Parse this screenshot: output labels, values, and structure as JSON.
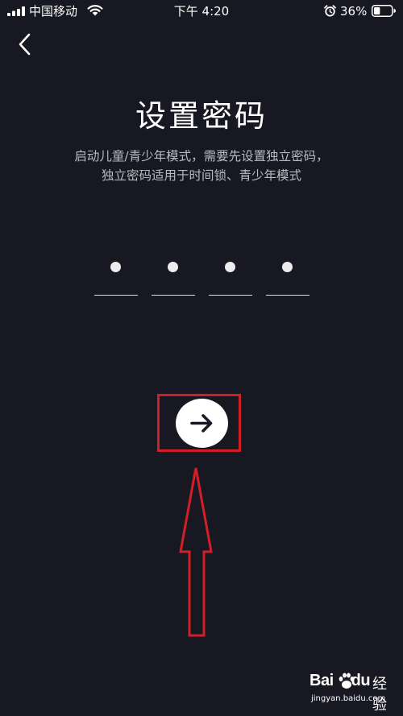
{
  "status_bar": {
    "carrier": "中国移动",
    "time": "下午 4:20",
    "battery_percent": "36%",
    "icons": [
      "signal-icon",
      "wifi-icon",
      "alarm-icon",
      "battery-icon"
    ],
    "battery_level": 0.36
  },
  "nav": {
    "back_icon": "chevron-left-icon"
  },
  "page": {
    "title": "设置密码",
    "description_lines": [
      "启动儿童/青少年模式，需要先设置独立密码，",
      "独立密码适用于时间锁、青少年模式"
    ]
  },
  "pin": {
    "length": 4,
    "filled": 4
  },
  "next_button": {
    "icon": "arrow-right-icon"
  },
  "annotation": {
    "highlight_color": "#d11f28",
    "pointer": "up-arrow"
  },
  "watermark": {
    "brand": "Bai",
    "brand_suffix": "du",
    "product": "经验",
    "url": "jingyan.baidu.com"
  },
  "colors": {
    "background": "#171821",
    "text_primary": "#ffffff",
    "text_secondary": "#b9bac0",
    "pin_dot": "#ececee",
    "button_bg": "#ffffff",
    "button_icon": "#171821",
    "annotation_red": "#d11f28"
  }
}
